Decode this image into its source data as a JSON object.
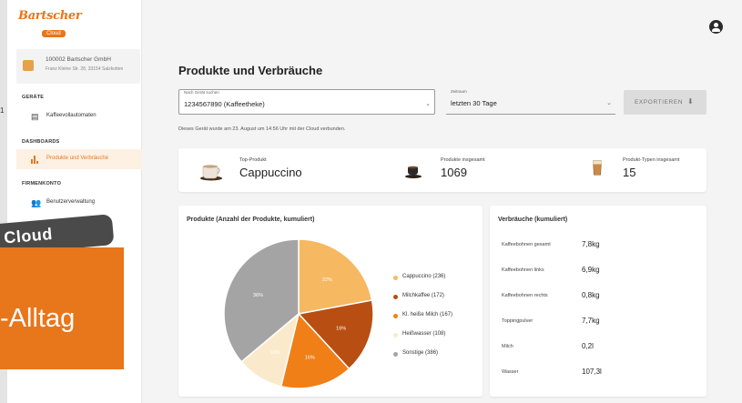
{
  "brand": {
    "logo_text": "Bartscher",
    "logo_sub": "Cloud",
    "accent": "#e8761b"
  },
  "sidebar": {
    "company_name": "100002 Bartscher GmbH",
    "company_address": "Franz Kleine Str. 28, 33154 Salzkotten",
    "sections": {
      "geraete": "GERÄTE",
      "dashboards": "DASHBOARDS",
      "firmenkonto": "FIRMENKONTO"
    },
    "items": [
      {
        "label": "Kaffeevollautomaten",
        "icon": "coffee-machine-icon"
      },
      {
        "label": "Produkte und Verbräuche",
        "icon": "bar-chart-icon",
        "active": true
      },
      {
        "label": "Benutzerverwaltung",
        "icon": "users-icon"
      }
    ]
  },
  "header": {
    "title": "Produkte und Verbräuche",
    "device_label": "Nach Gerät suchen",
    "device_value": "1234567890 (Kaffeetheke)",
    "range_label": "Zeitraum",
    "range_value": "letzten 30 Tage",
    "export_label": "EXPORTIEREN",
    "info": "Dieses Gerät wurde am 23. August um 14:56 Uhr mit der Cloud verbunden."
  },
  "kpis": [
    {
      "label": "Top-Produkt",
      "value": "Cappuccino"
    },
    {
      "label": "Produkte insgesamt",
      "value": "1069"
    },
    {
      "label": "Produkt-Typen insgesamt",
      "value": "15"
    }
  ],
  "pie": {
    "title": "Produkte (Anzahl der Produkte, kumuliert)"
  },
  "chart_data": {
    "type": "pie",
    "title": "Produkte (Anzahl der Produkte, kumuliert)",
    "categories": [
      "Cappuccino",
      "Milchkaffee",
      "Kl. heiße Milch",
      "Heißwasser",
      "Sonstige"
    ],
    "values": [
      236,
      172,
      167,
      108,
      386
    ],
    "slice_labels": [
      "22%",
      "16%",
      "16%",
      "10%",
      "36%"
    ],
    "legend_labels": [
      "Cappuccino (236)",
      "Milchkaffee (172)",
      "Kl. heiße Milch (167)",
      "Heißwasser (108)",
      "Sonstige (386)"
    ],
    "colors": [
      "#f6b860",
      "#b84e12",
      "#f07f17",
      "#faeacb",
      "#a4a4a4"
    ],
    "legend_position": "right"
  },
  "consumption": {
    "title": "Verbräuche (kumuliert)",
    "rows": [
      {
        "label": "Kaffeebohnen gesamt",
        "value": "7,8kg"
      },
      {
        "label": "Kaffeebohnen links",
        "value": "6,9kg"
      },
      {
        "label": "Kaffeebohnen rechts",
        "value": "0,8kg"
      },
      {
        "label": "Toppingpulver",
        "value": "7,7kg"
      },
      {
        "label": "Milch",
        "value": "0,2l"
      },
      {
        "label": "Wasser",
        "value": "107,3l"
      }
    ]
  },
  "overlay": {
    "cloud": "Cloud",
    "alltag": "-Alltag",
    "edge_num": "1"
  }
}
